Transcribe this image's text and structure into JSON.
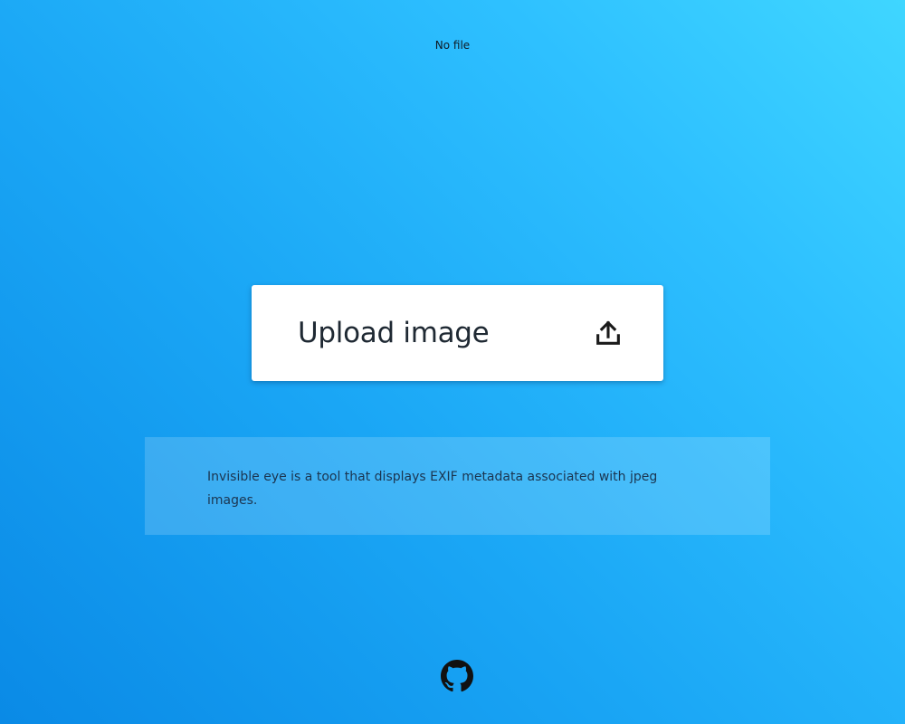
{
  "header": {
    "status_text": "No file"
  },
  "upload": {
    "label": "Upload image",
    "icon": "upload-icon"
  },
  "info": {
    "description": "Invisible eye is a tool that displays EXIF metadata associated with jpeg images."
  },
  "footer": {
    "icon": "github-icon"
  },
  "colors": {
    "background_gradient": [
      "#0a8ae6",
      "#3fd6ff"
    ],
    "button_bg": "#ffffff",
    "text_dark": "#1f2933"
  }
}
